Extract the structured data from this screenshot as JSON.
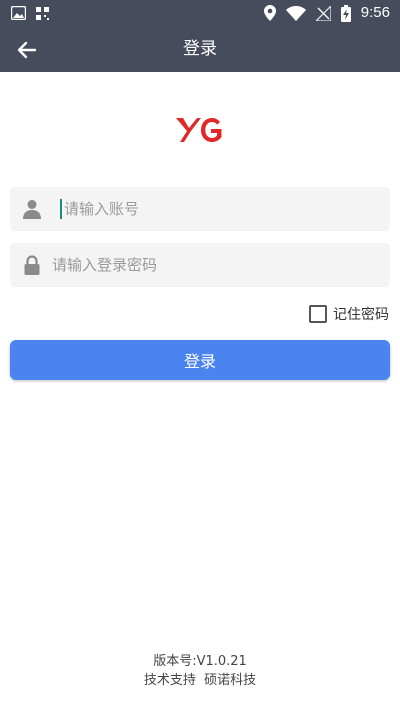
{
  "status_bar": {
    "time": "9:56",
    "icons": [
      "image-icon",
      "qr-icon",
      "location-icon",
      "wifi-icon",
      "signal-icon",
      "battery-icon"
    ]
  },
  "app_bar": {
    "title": "登录",
    "back_icon": "arrow-left-icon",
    "background": "#474c5c"
  },
  "logo": {
    "text": "YG",
    "color": "#e02a2a"
  },
  "form": {
    "account_placeholder": "请输入账号",
    "account_value": "",
    "password_placeholder": "请输入登录密码",
    "password_value": "",
    "remember_label": "记住密码",
    "remember_checked": false,
    "submit_label": "登录",
    "submit_color": "#4b84ee"
  },
  "footer": {
    "version": "版本号:V1.0.21",
    "support": "技术支持  硕诺科技"
  }
}
